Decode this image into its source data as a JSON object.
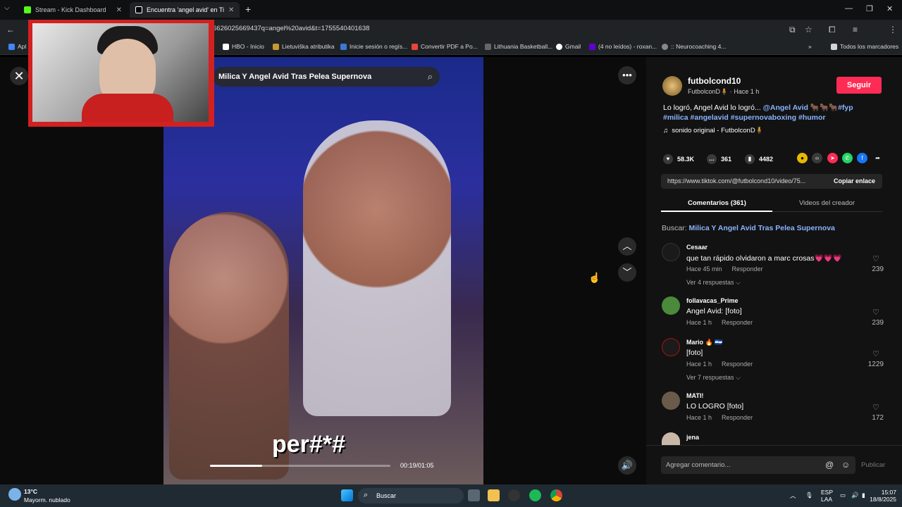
{
  "browser": {
    "tabs": [
      {
        "title": "Stream - Kick Dashboard",
        "active": false
      },
      {
        "title": "Encuentra 'angel avid' en Ti",
        "active": true
      }
    ],
    "new_tab": "+",
    "url": "6626025669437q=angel%20avid&t=1755540401638",
    "bookmarks": [
      "Apl",
      "HBO - Inicio",
      "Lietuviška atributika",
      "Inicie sesión o regís...",
      "Convertir PDF a Po...",
      "Lithuania Basketball...",
      "Gmail",
      "(4 no leídos) - roxan...",
      ":: Neurocoaching 4...",
      "Todos los marcadores"
    ]
  },
  "video": {
    "search_text": "Milica Y Angel Avid Tras Pelea Supernova",
    "caption": "per#*#",
    "time": "00:19/01:05",
    "progress_pct": 29
  },
  "author": {
    "username": "futbolcond10",
    "display": "FutbolconD🧍",
    "time": "Hace 1 h",
    "follow_label": "Seguir"
  },
  "post": {
    "desc_text": "Lo logró, Angel Avid lo logró... ",
    "desc_tags": "@Angel Avid 🐂🐂🐂#fyp #milica #angelavid #supernovaboxing #humor",
    "sound": "sonido original - FutbolconD🧍",
    "likes": "58.3K",
    "comments": "361",
    "saves": "4482",
    "link": "https://www.tiktok.com/@futbolcond10/video/75...",
    "copy_label": "Copiar enlace"
  },
  "panel_tabs": {
    "comments": "Comentarios (361)",
    "creator": "Videos del creador"
  },
  "search_hint": {
    "prefix": "Buscar: ",
    "query": "Milica Y Angel Avid Tras Pelea Supernova"
  },
  "comments": [
    {
      "name": "Cesaar",
      "text": "que tan rápido olvidaron a marc crosas💗💗💗",
      "time": "Hace 45 min",
      "reply": "Responder",
      "likes": "239",
      "more": "Ver 4 respuestas ⌵"
    },
    {
      "name": "follavacas_Prime",
      "text": "Angel Avid: [foto]",
      "time": "Hace 1 h",
      "reply": "Responder",
      "likes": "239",
      "more": ""
    },
    {
      "name": "Mario 🔥 🇸🇻",
      "text": "[foto]",
      "time": "Hace 1 h",
      "reply": "Responder",
      "likes": "1229",
      "more": "Ver 7 respuestas ⌵"
    },
    {
      "name": "MATI!",
      "text": "LO LOGRO [foto]",
      "time": "Hace 1 h",
      "reply": "Responder",
      "likes": "172",
      "more": ""
    },
    {
      "name": "jena",
      "text": "",
      "time": "",
      "reply": "",
      "likes": "",
      "more": ""
    }
  ],
  "comment_box": {
    "placeholder": "Agregar comentario...",
    "publish": "Publicar"
  },
  "taskbar": {
    "weather_temp": "13°C",
    "weather_desc": "Mayorm. nublado",
    "search": "Buscar",
    "lang1": "ESP",
    "lang2": "LAA",
    "time": "15:07",
    "date": "18/8/2025"
  }
}
